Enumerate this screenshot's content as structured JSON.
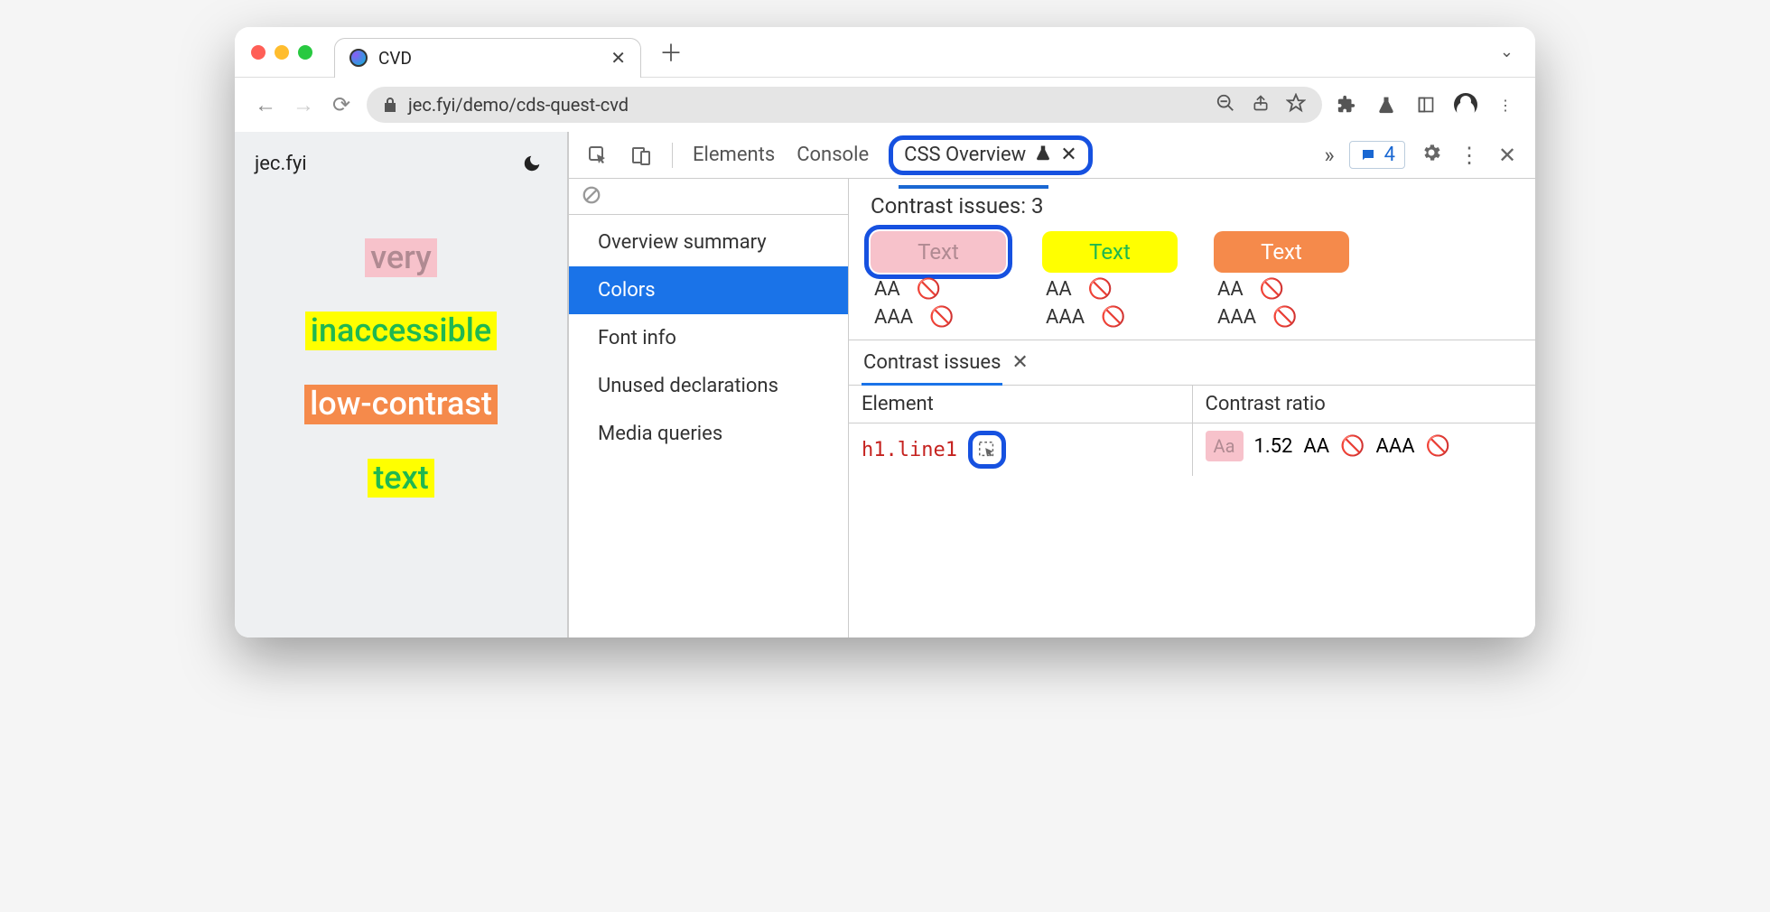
{
  "browser": {
    "tab_title": "CVD",
    "url_display": "jec.fyi/demo/cds-quest-cvd"
  },
  "page": {
    "site_label": "jec.fyi",
    "words": [
      {
        "text": "very",
        "fg": "#b08a92",
        "bg": "#f7c2cb"
      },
      {
        "text": "inaccessible",
        "fg": "#1fb850",
        "bg": "#ffff00"
      },
      {
        "text": "low-contrast",
        "fg": "#ffffff",
        "bg": "#f58a4b"
      },
      {
        "text": "text",
        "fg": "#1fb850",
        "bg": "#ffff00"
      }
    ]
  },
  "devtools": {
    "tabs": {
      "elements": "Elements",
      "console": "Console",
      "css_overview": "CSS Overview"
    },
    "issues_count": "4",
    "sidebar": [
      "Overview summary",
      "Colors",
      "Font info",
      "Unused declarations",
      "Media queries"
    ],
    "sidebar_active": "Colors",
    "contrast": {
      "heading": "Contrast issues: 3",
      "swatches": [
        {
          "label": "Text",
          "fg": "#b08a92",
          "bg": "#f7c2cb",
          "ringed": true
        },
        {
          "label": "Text",
          "fg": "#1fb850",
          "bg": "#ffff00",
          "ringed": false
        },
        {
          "label": "Text",
          "fg": "#ffffff",
          "bg": "#f58a4b",
          "ringed": false
        }
      ],
      "aa_label": "AA",
      "aaa_label": "AAA"
    },
    "issues_panel": {
      "tab_label": "Contrast issues",
      "columns": {
        "element": "Element",
        "ratio": "Contrast ratio"
      },
      "row": {
        "element_code": "h1.line1",
        "ratio_swatch": "Aa",
        "ratio_value": "1.52",
        "aa": "AA",
        "aaa": "AAA"
      }
    }
  }
}
